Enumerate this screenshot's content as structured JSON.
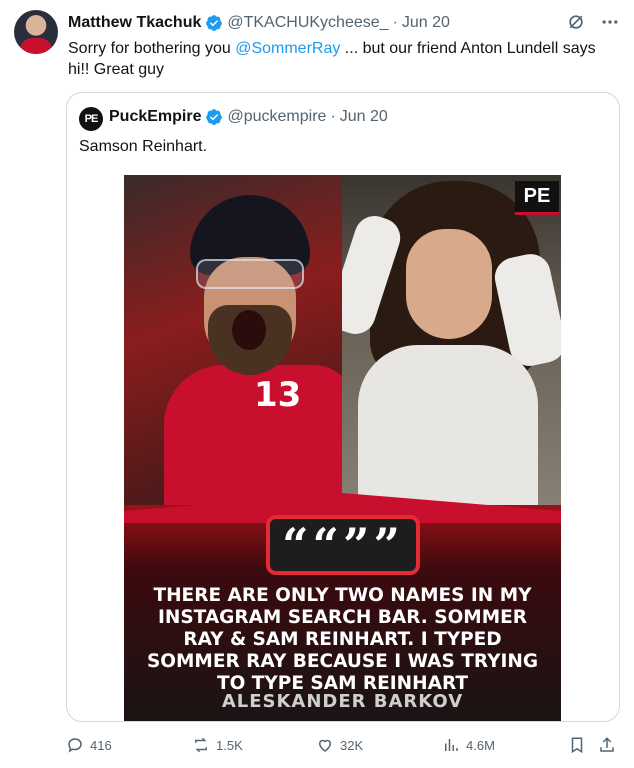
{
  "tweet": {
    "author_name": "Matthew Tkachuk",
    "handle": "@TKACHUKycheese_",
    "separator": "·",
    "date": "Jun 20",
    "text_before": "Sorry for bothering you ",
    "mention": "@SommerRay",
    "text_after": " ... but our friend Anton Lundell says hi!! Great guy"
  },
  "quoted": {
    "avatar_text": "PE",
    "author_name": "PuckEmpire",
    "handle": "@puckempire",
    "separator": "·",
    "date": "Jun 20",
    "text": "Samson Reinhart.",
    "media": {
      "logo_text": "PE",
      "quote_mark": "““””",
      "player_number": "13",
      "caption": "THERE ARE ONLY TWO NAMES IN MY INSTAGRAM SEARCH BAR. SOMMER RAY & SAM REINHART. I TYPED SOMMER RAY BECAUSE I WAS TRYING TO TYPE SAM REINHART",
      "attribution": "ALESKANDER BARKOV"
    }
  },
  "actions": {
    "replies": "416",
    "reposts": "1.5K",
    "likes": "32K",
    "views": "4.6M"
  },
  "colors": {
    "accent": "#1d9bf0",
    "muted": "#536471",
    "brand_red": "#c8102e"
  }
}
